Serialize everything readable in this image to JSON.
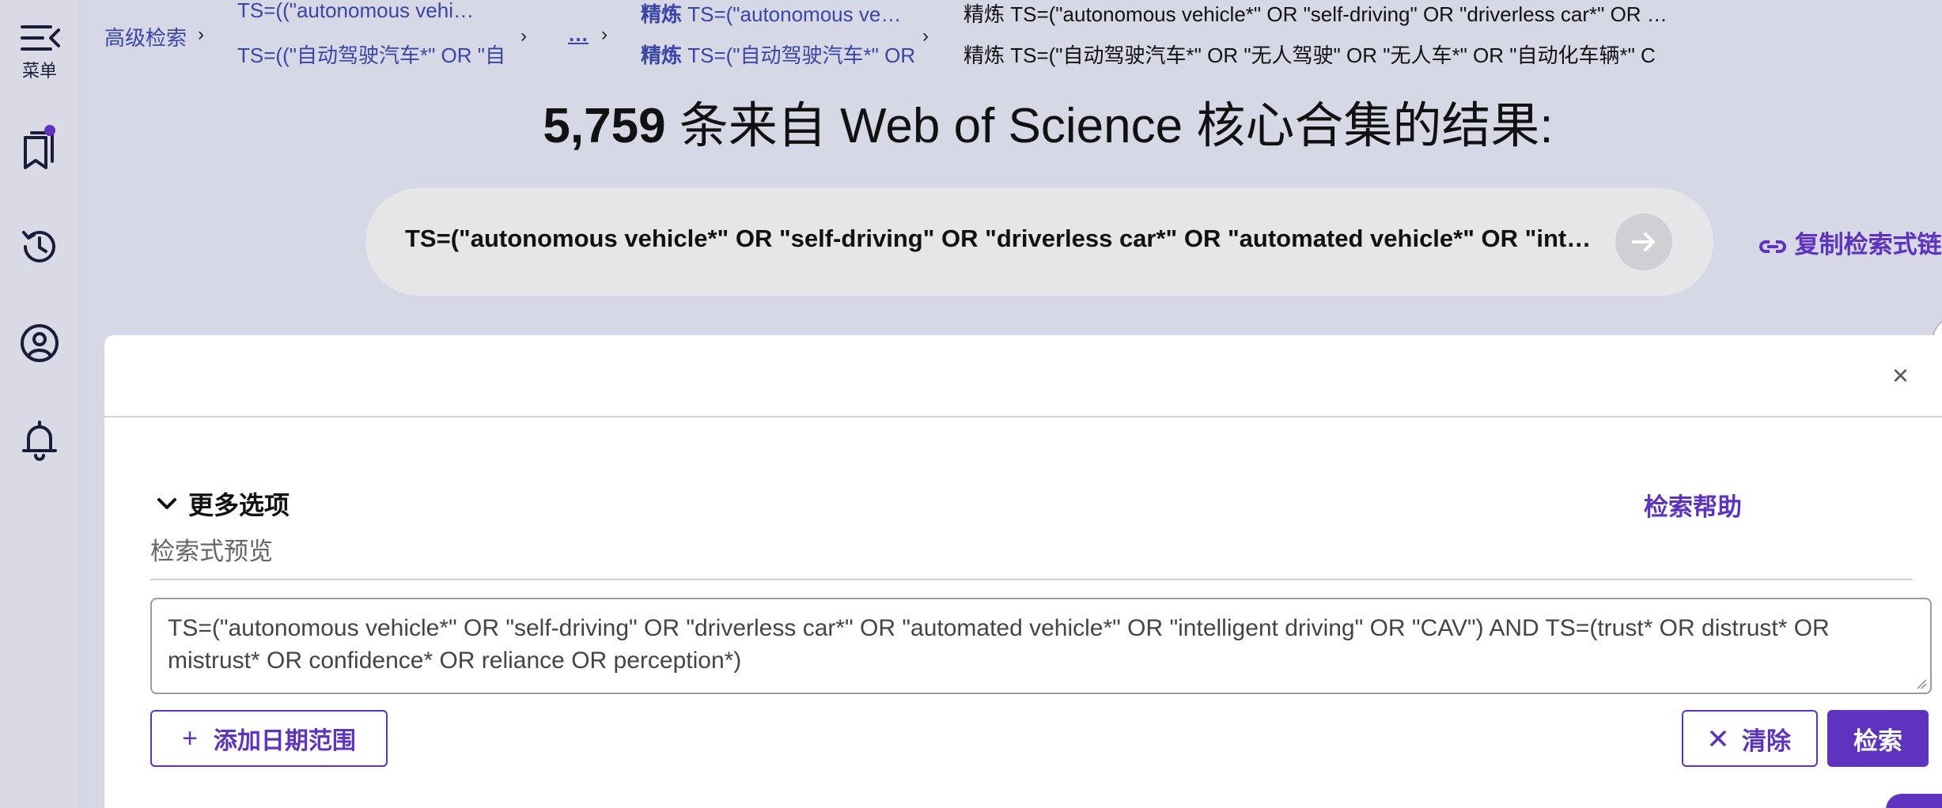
{
  "rail": {
    "menu_label": "菜单"
  },
  "breadcrumbs": {
    "advanced_search": "高级检索",
    "query1_line1": "TS=((\"autonomous vehicle*\"…",
    "query1_line2": "TS=((\"自动驾驶汽车*\" OR \"自",
    "ellipsis": "…",
    "refine_word": "精炼",
    "refine2_line1": " TS=(\"autonomous ve…",
    "refine2_line2": " TS=(\"自动驾驶汽车*\" OR",
    "refine3_line1": "精炼 TS=(\"autonomous vehicle*\" OR \"self-driving\" OR \"driverless car*\" OR …",
    "refine3_line2": "精炼 TS=(\"自动驾驶汽车*\" OR \"无人驾驶\" OR \"无人车*\" OR \"自动化车辆*\" C"
  },
  "results": {
    "count": "5,759",
    "title_rest": " 条来自 Web of Science 核心合集的结果:"
  },
  "query_pill": {
    "text": "TS=(\"autonomous vehicle*\" OR \"self-driving\" OR \"driverless car*\" OR \"automated vehicle*\" OR \"intelligent driving\" OR \"CAV\") AND TS=(trust* OR distrust* OR mistrust* OR confidence* OR reliance OR perception*)",
    "copy_link_label": "复制检索式链"
  },
  "panel": {
    "close_label": "×",
    "more_options": "更多选项",
    "search_help": "检索帮助",
    "preview_label": "检索式预览",
    "query_text": "TS=(\"autonomous vehicle*\" OR \"self-driving\" OR \"driverless car*\" OR \"automated vehicle*\" OR \"intelligent driving\" OR \"CAV\") AND TS=(trust* OR distrust* OR mistrust* OR confidence* OR reliance OR perception*)",
    "add_date_label": "添加日期范围",
    "clear_label": "清除",
    "search_label": "检索"
  },
  "colors": {
    "accent": "#5e33bf",
    "link": "#3a45a8",
    "background": "#d6d8e6"
  }
}
